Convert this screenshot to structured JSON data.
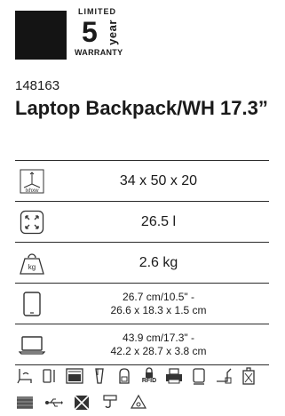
{
  "warranty": {
    "top": "LIMITED",
    "number": "5",
    "unit": "year",
    "bottom": "WARRANTY"
  },
  "product": {
    "sku": "148163",
    "title": "Laptop Backpack/WH 17.3”"
  },
  "specs": [
    {
      "icon": "dimensions-icon",
      "icon_text": "lxhxw",
      "value": "34 x 50 x 20"
    },
    {
      "icon": "volume-icon",
      "value": "26.5 l"
    },
    {
      "icon": "weight-icon",
      "icon_text": "kg",
      "value": "2.6 kg"
    },
    {
      "icon": "tablet-icon",
      "line1": "26.7 cm/10.5\" -",
      "line2": "26.6 x 18.3 x 1.5 cm"
    },
    {
      "icon": "laptop-icon",
      "line1": "43.9 cm/17.3\" -",
      "line2": "42.2 x 28.7 x 3.8 cm"
    }
  ],
  "features": {
    "rfid_label": "RFID",
    "row1": [
      "chair-strap-icon",
      "phone-pocket-icon",
      "organizer-icon",
      "bottle-pocket-icon",
      "backpack-icon",
      "rfid-lock-icon",
      "printer-icon",
      "trolley-icon",
      "cable-port-icon",
      "luggage-tag-icon"
    ],
    "row2": [
      "fabric-icon",
      "usb-icon",
      "no-wash-icon",
      "hook-icon",
      "recycle-icon"
    ]
  }
}
